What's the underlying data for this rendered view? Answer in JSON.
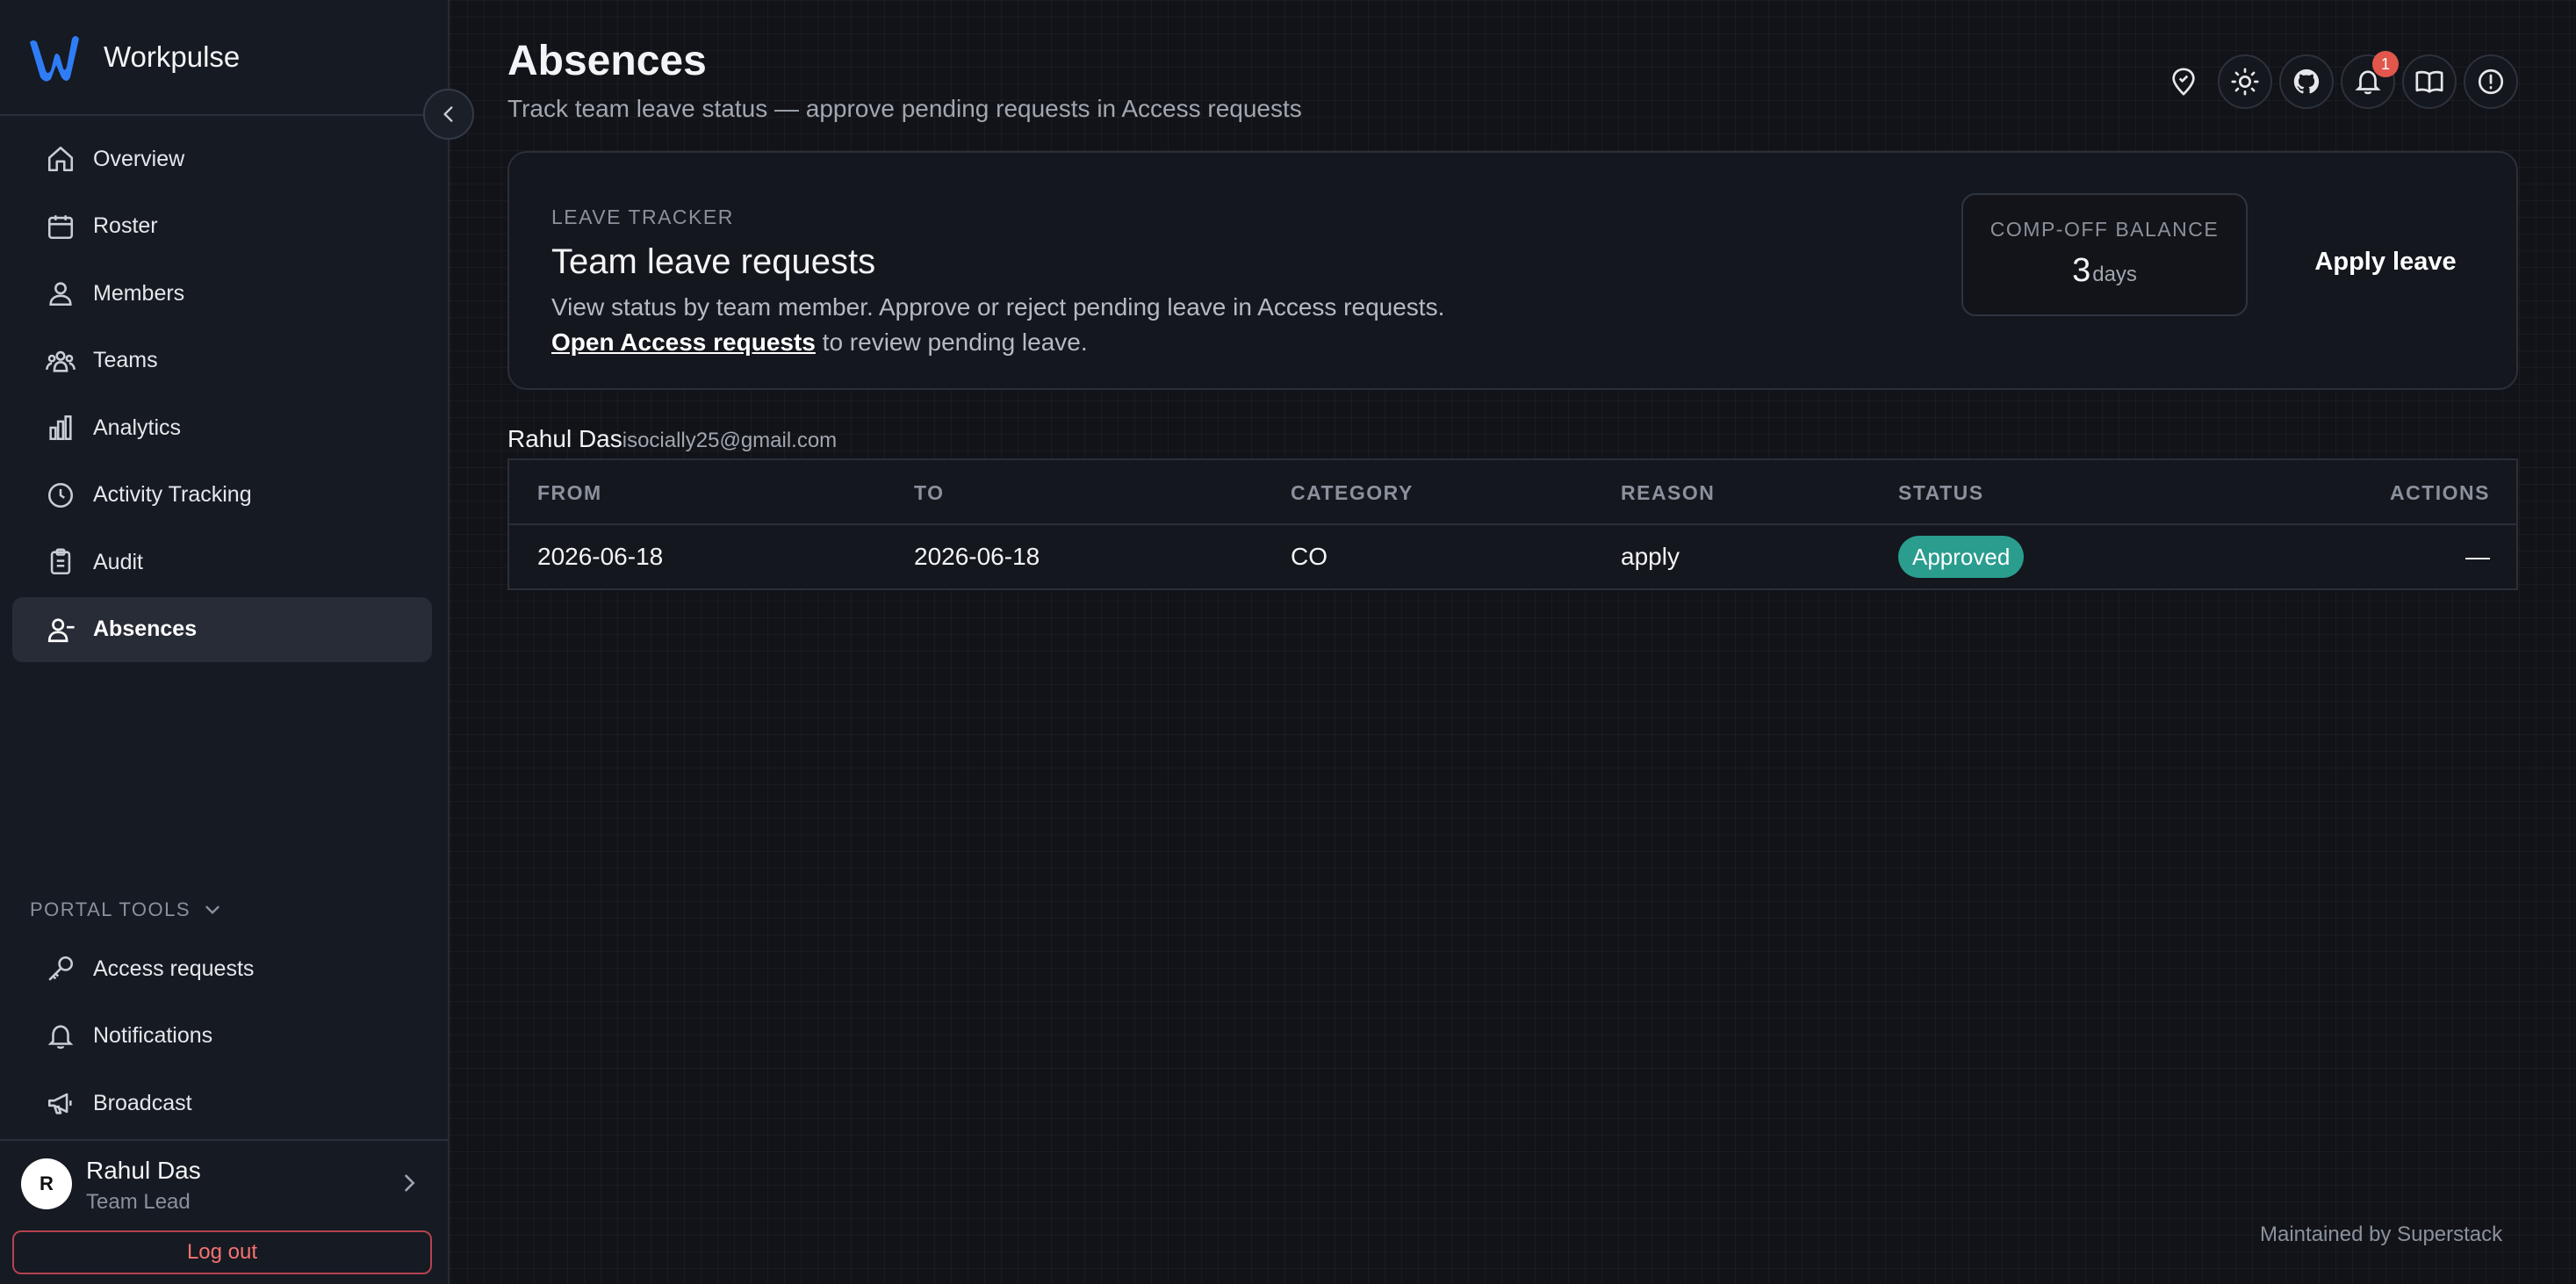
{
  "app": {
    "name": "Workpulse"
  },
  "sidebar": {
    "items": [
      {
        "label": "Overview",
        "icon": "home-icon"
      },
      {
        "label": "Roster",
        "icon": "calendar-icon"
      },
      {
        "label": "Members",
        "icon": "users-icon"
      },
      {
        "label": "Teams",
        "icon": "team-icon"
      },
      {
        "label": "Analytics",
        "icon": "bar-chart-icon"
      },
      {
        "label": "Activity Tracking",
        "icon": "clock-icon"
      },
      {
        "label": "Audit",
        "icon": "clipboard-icon"
      },
      {
        "label": "Absences",
        "icon": "user-minus-icon",
        "active": true
      }
    ],
    "portal_tools": {
      "heading": "PORTAL TOOLS",
      "items": [
        {
          "label": "Access requests",
          "icon": "key-icon"
        },
        {
          "label": "Notifications",
          "icon": "bell-icon"
        },
        {
          "label": "Broadcast",
          "icon": "megaphone-icon"
        }
      ]
    },
    "user": {
      "initial": "R",
      "name": "Rahul Das",
      "role": "Team Lead"
    },
    "logout_label": "Log out"
  },
  "header": {
    "title": "Absences",
    "subtitle": "Track team leave status — approve pending requests in Access requests",
    "notification_count": "1"
  },
  "tracker": {
    "eyebrow": "LEAVE TRACKER",
    "heading": "Team leave requests",
    "description": "View status by team member. Approve or reject pending leave in Access requests.",
    "link_label": "Open Access requests",
    "link_suffix": " to review pending leave.",
    "balance_label": "COMP-OFF BALANCE",
    "balance_value": "3",
    "balance_unit": "days",
    "apply_label": "Apply leave"
  },
  "member": {
    "name": "Rahul Das",
    "email": "isocially25@gmail.com"
  },
  "table": {
    "headers": [
      "FROM",
      "TO",
      "CATEGORY",
      "REASON",
      "STATUS",
      "ACTIONS"
    ],
    "rows": [
      {
        "from": "2026-06-18",
        "to": "2026-06-18",
        "category": "CO",
        "reason": "apply",
        "status": "Approved",
        "actions": "—"
      }
    ]
  },
  "footer": {
    "text": "Maintained by Superstack"
  },
  "colors": {
    "accent_status": "#2a9d8f",
    "logout": "#f87171",
    "badge": "#e2574c",
    "brand": "#2f7df6"
  }
}
